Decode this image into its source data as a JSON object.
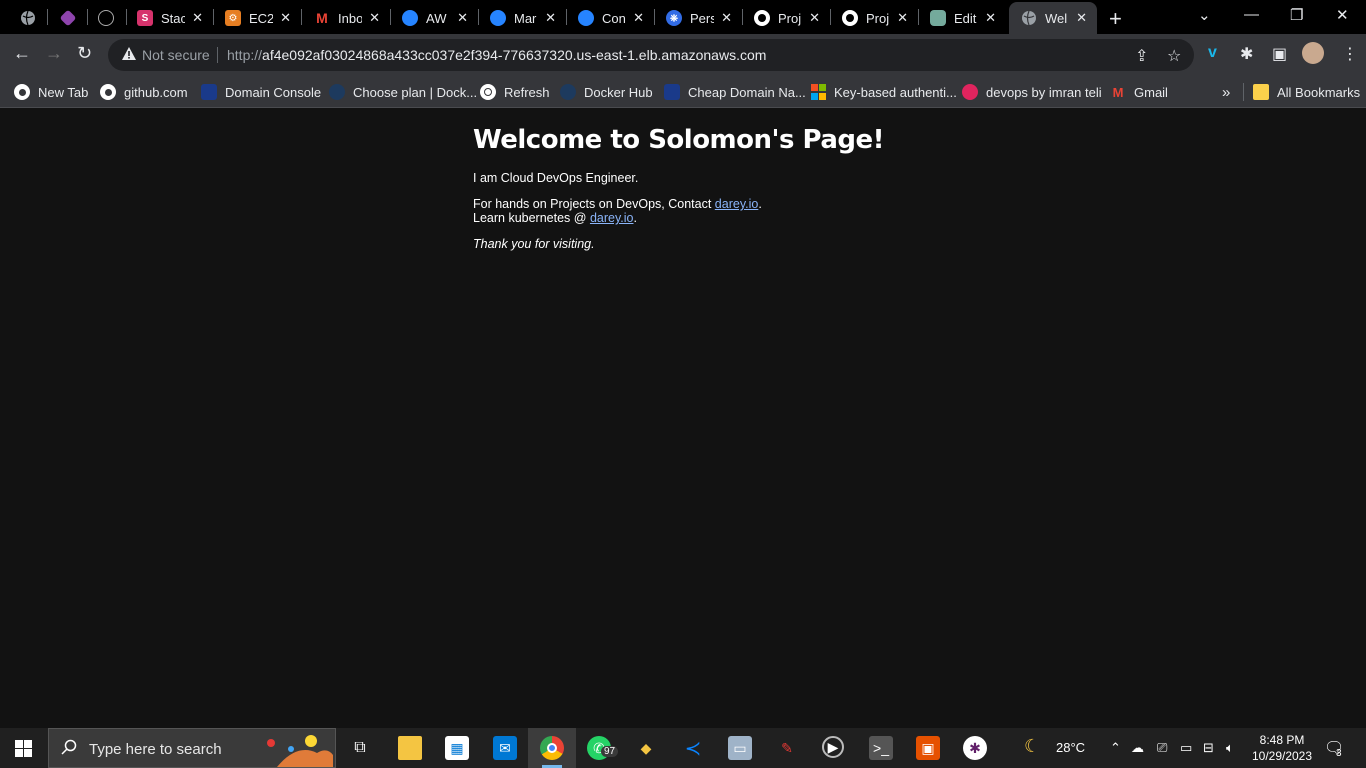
{
  "tabs": [
    {
      "title": "",
      "icon": "globe-icon"
    },
    {
      "title": "",
      "icon": "gem-icon"
    },
    {
      "title": "",
      "icon": "chatgpt-icon"
    },
    {
      "title": "Stac",
      "icon": "stack-icon"
    },
    {
      "title": "EC2",
      "icon": "aws-ec2-icon"
    },
    {
      "title": "Inbo",
      "icon": "gmail-icon"
    },
    {
      "title": "AW",
      "icon": "atlassian-icon"
    },
    {
      "title": "Mar",
      "icon": "atlassian-icon"
    },
    {
      "title": "Con",
      "icon": "atlassian-icon"
    },
    {
      "title": "Pers",
      "icon": "kubernetes-icon"
    },
    {
      "title": "Proj",
      "icon": "github-icon"
    },
    {
      "title": "Proj",
      "icon": "github-icon"
    },
    {
      "title": "Edit",
      "icon": "chatgpt-icon"
    },
    {
      "title": "Wel",
      "icon": "globe-icon",
      "active": true
    }
  ],
  "omnibox": {
    "security_label": "Not secure",
    "url_scheme": "http://",
    "url_host": "af4e092af03024868a433cc037e2f394-776637320.us-east-1.elb.amazonaws.com"
  },
  "bookmarks": [
    {
      "label": "New Tab",
      "icon": "github-icon"
    },
    {
      "label": "github.com",
      "icon": "github-icon"
    },
    {
      "label": "Domain Console",
      "icon": "domain-icon"
    },
    {
      "label": "Choose plan | Dock...",
      "icon": "docker-icon"
    },
    {
      "label": "Refresh",
      "icon": "globe-icon"
    },
    {
      "label": "Docker Hub",
      "icon": "docker-icon"
    },
    {
      "label": "Cheap Domain Na...",
      "icon": "domain-icon"
    },
    {
      "label": "Key-based authenti...",
      "icon": "microsoft-icon"
    },
    {
      "label": "devops by imran teli",
      "icon": "udemy-icon"
    },
    {
      "label": "Gmail",
      "icon": "gmail-icon"
    },
    {
      "label": "All Bookmarks",
      "icon": "folder-icon"
    }
  ],
  "page": {
    "heading": "Welcome to Solomon's Page!",
    "line1": "I am Cloud DevOps Engineer.",
    "line2_prefix": "For hands on Projects on DevOps, Contact ",
    "line2_link": "darey.io",
    "line2_suffix": ".",
    "line3_prefix": "Learn kubernetes @ ",
    "line3_link": "darey.io",
    "line3_suffix": ".",
    "thanks": "Thank you for visiting."
  },
  "taskbar": {
    "search_placeholder": "Type here to search",
    "whatsapp_badge": "97",
    "weather_temp": "28°C",
    "clock_time": "8:48 PM",
    "clock_date": "10/29/2023",
    "notification_count": "3"
  },
  "colors": {
    "page_bg": "#121212",
    "link": "#8ab4f8",
    "chrome_toolbar": "#35363a",
    "tabstrip": "#000000",
    "taskbar": "#202020"
  }
}
